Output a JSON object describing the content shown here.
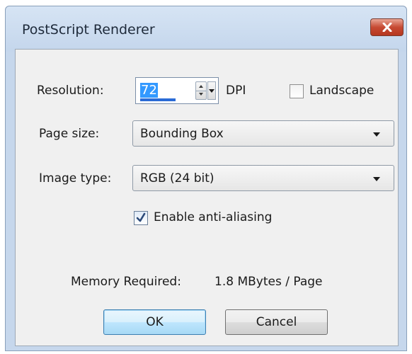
{
  "window": {
    "title": "PostScript Renderer"
  },
  "resolution": {
    "label": "Resolution:",
    "value": "72",
    "unit": "DPI"
  },
  "landscape": {
    "label": "Landscape",
    "checked": false
  },
  "page_size": {
    "label": "Page size:",
    "selected": "Bounding Box"
  },
  "image_type": {
    "label": "Image type:",
    "selected": "RGB (24 bit)"
  },
  "antialias": {
    "label": "Enable anti-aliasing",
    "checked": true
  },
  "memory": {
    "label": "Memory Required:",
    "value": "1.8 MBytes / Page"
  },
  "buttons": {
    "ok": "OK",
    "cancel": "Cancel"
  },
  "colors": {
    "title_bar": "#c6d7ec",
    "close_button": "#c74a33",
    "selection": "#3399ff",
    "dialog_face": "#f0f0f0"
  }
}
